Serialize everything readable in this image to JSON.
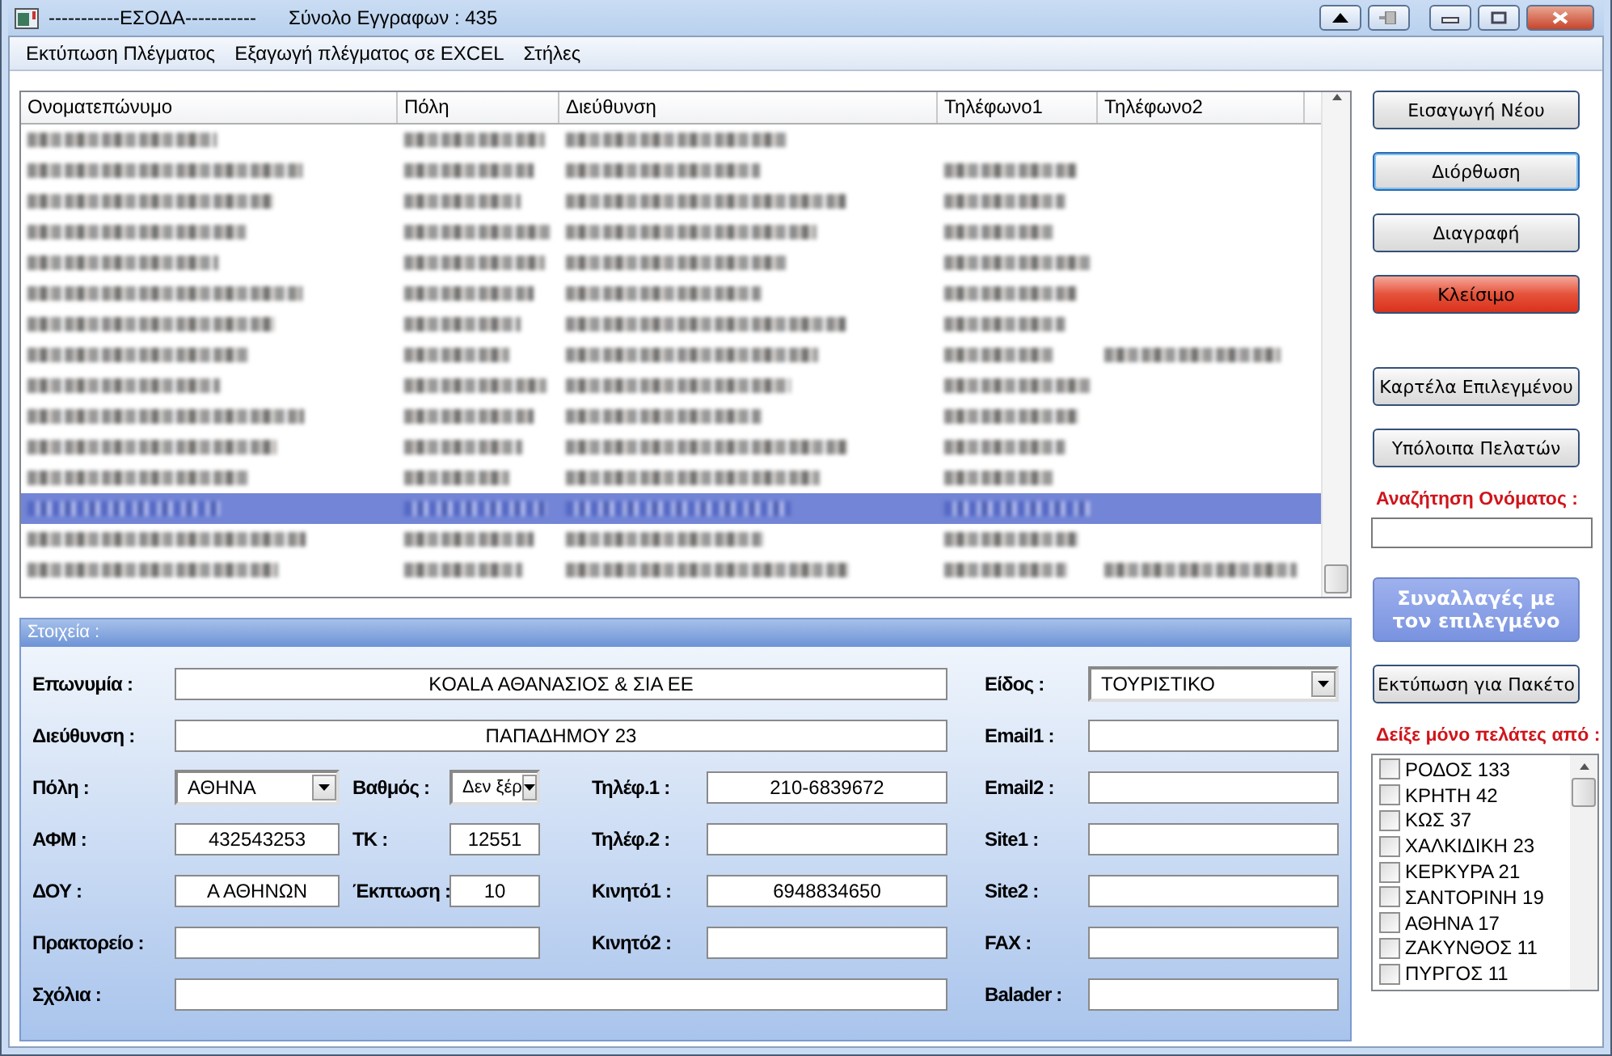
{
  "window": {
    "title": "-----------ΕΣΟΔΑ-----------",
    "record_count": "Σύνολο Εγγραφων : 435"
  },
  "menu": [
    "Εκτύπωση Πλέγματος",
    "Εξαγωγή πλέγματος σε EXCEL",
    "Στήλες"
  ],
  "grid": {
    "columns": [
      "Ονοματεπώνυμο",
      "Πόλη",
      "Διεύθυνση",
      "Τηλέφωνο1",
      "Τηλέφωνο2"
    ],
    "rows": [
      {
        "selected": false,
        "filled": [
          true,
          true,
          true,
          false,
          false
        ]
      },
      {
        "selected": false,
        "filled": [
          true,
          true,
          true,
          true,
          false
        ]
      },
      {
        "selected": false,
        "filled": [
          true,
          true,
          true,
          true,
          false
        ]
      },
      {
        "selected": false,
        "filled": [
          true,
          true,
          true,
          true,
          false
        ]
      },
      {
        "selected": false,
        "filled": [
          true,
          true,
          true,
          true,
          false
        ]
      },
      {
        "selected": false,
        "filled": [
          true,
          true,
          true,
          true,
          false
        ]
      },
      {
        "selected": false,
        "filled": [
          true,
          true,
          true,
          true,
          false
        ]
      },
      {
        "selected": false,
        "filled": [
          true,
          true,
          true,
          true,
          true
        ]
      },
      {
        "selected": false,
        "filled": [
          true,
          true,
          true,
          true,
          false
        ]
      },
      {
        "selected": false,
        "filled": [
          true,
          true,
          true,
          true,
          false
        ]
      },
      {
        "selected": false,
        "filled": [
          true,
          true,
          true,
          true,
          false
        ]
      },
      {
        "selected": false,
        "filled": [
          true,
          true,
          true,
          true,
          false
        ]
      },
      {
        "selected": true,
        "filled": [
          true,
          true,
          true,
          true,
          false
        ]
      },
      {
        "selected": false,
        "filled": [
          true,
          true,
          true,
          true,
          false
        ]
      },
      {
        "selected": false,
        "filled": [
          true,
          true,
          true,
          true,
          true
        ]
      }
    ]
  },
  "details": {
    "title": "Στοιχεία :",
    "fields": [
      {
        "label": "Επωνυμία :",
        "kind": "text",
        "value": "KOALA ΑΘΑΝΑΣΙΟΣ & ΣΙΑ ΕΕ"
      },
      {
        "label": "Είδος :",
        "kind": "combo",
        "value": "ΤΟΥΡΙΣΤΙΚΟ"
      },
      {
        "label": "Διεύθυνση :",
        "kind": "text",
        "value": "ΠΑΠΑΔΗΜΟΥ 23"
      },
      {
        "label": "Email1 :",
        "kind": "text"
      },
      {
        "label": "Πόλη :",
        "kind": "combo",
        "value": "ΑΘΗΝΑ"
      },
      {
        "label": "Βαθμός :",
        "kind": "combo",
        "value": "Δεν ξέρ"
      },
      {
        "label": "Τηλέφ.1 :",
        "kind": "text",
        "value": "210-6839672"
      },
      {
        "label": "Email2 :",
        "kind": "text"
      },
      {
        "label": "ΑΦΜ :",
        "kind": "text",
        "value": "432543253"
      },
      {
        "label": "ΤΚ :",
        "kind": "text",
        "value": "12551"
      },
      {
        "label": "Τηλέφ.2 :",
        "kind": "text"
      },
      {
        "label": "Site1 :",
        "kind": "text"
      },
      {
        "label": "ΔΟΥ :",
        "kind": "text",
        "value": "Α ΑΘΗΝΩΝ"
      },
      {
        "label": "Έκπτωση :",
        "kind": "text",
        "value": "10"
      },
      {
        "label": "Κινητό1 :",
        "kind": "text",
        "value": "6948834650"
      },
      {
        "label": "Site2 :",
        "kind": "text"
      },
      {
        "label": "Πρακτορείο :",
        "kind": "text"
      },
      {
        "label": "Κινητό2 :",
        "kind": "text"
      },
      {
        "label": "FAX :",
        "kind": "text"
      },
      {
        "label": "Σχόλια :",
        "kind": "text"
      },
      {
        "label": "Balader :",
        "kind": "text"
      }
    ]
  },
  "side": [
    {
      "kind": "button",
      "label": "Εισαγωγή Νέου"
    },
    {
      "kind": "default",
      "label": "Διόρθωση"
    },
    {
      "kind": "button",
      "label": "Διαγραφή"
    },
    {
      "kind": "danger",
      "label": "Κλείσιμο"
    },
    {
      "kind": "spacer"
    },
    {
      "kind": "button",
      "label": "Καρτέλα Επιλεγμένου"
    },
    {
      "kind": "button",
      "label": "Υπόλοιπα Πελατών"
    },
    {
      "kind": "heading",
      "label": "Αναζήτηση Ονόματος :"
    },
    {
      "kind": "search"
    },
    {
      "kind": "primary",
      "label": "Συναλλαγές με τον επιλεγμένο"
    },
    {
      "kind": "button",
      "label": "Εκτύπωση για Πακέτο"
    },
    {
      "kind": "heading",
      "label": "Δείξε μόνο πελάτες από :"
    }
  ],
  "region_filter": [
    {
      "label": "ΡΟΔΟΣ 133",
      "checked": false
    },
    {
      "label": "ΚΡΗΤΗ 42",
      "checked": false
    },
    {
      "label": "ΚΩΣ 37",
      "checked": false
    },
    {
      "label": "ΧΑΛΚΙΔΙΚΗ 23",
      "checked": false
    },
    {
      "label": "ΚΕΡΚΥΡΑ 21",
      "checked": false
    },
    {
      "label": "ΣΑΝΤΟΡΙΝΗ 19",
      "checked": false
    },
    {
      "label": "ΑΘΗΝΑ 17",
      "checked": false
    },
    {
      "label": "ΖΑΚΥΝΘΟΣ 11",
      "checked": false
    },
    {
      "label": "ΠΥΡΓΟΣ 11",
      "checked": false
    }
  ]
}
